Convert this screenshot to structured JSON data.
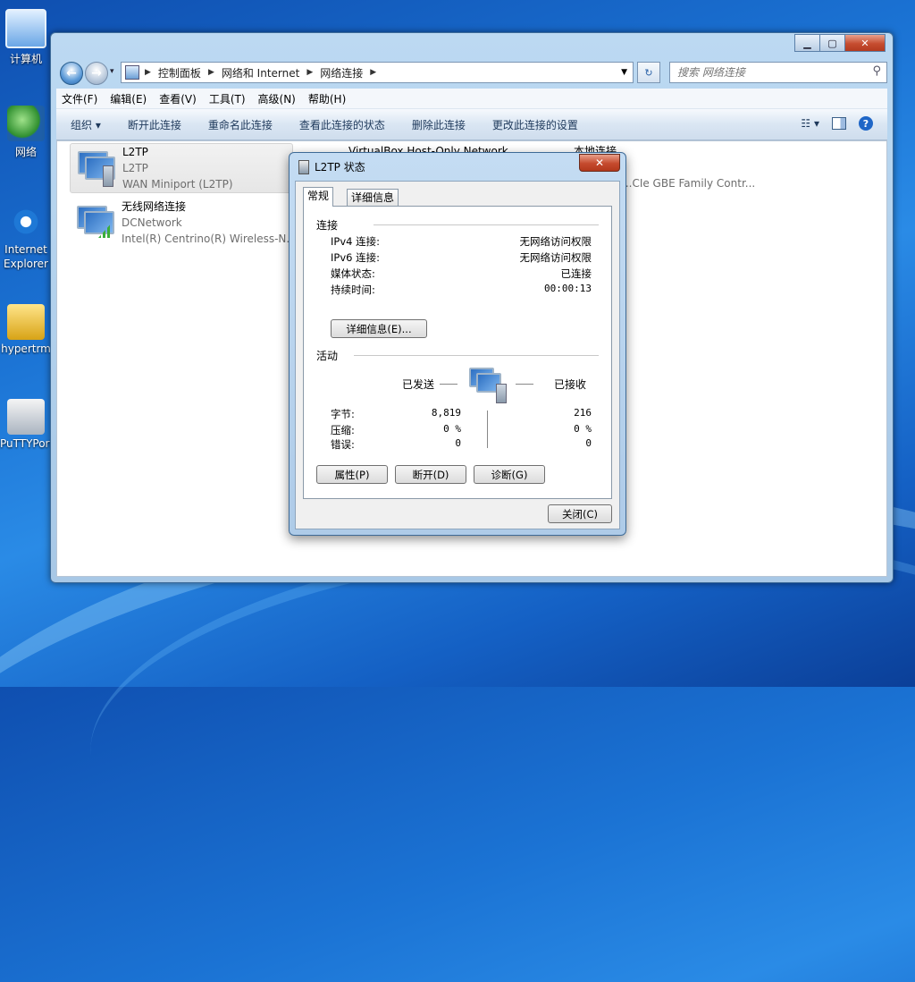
{
  "desktop": {
    "icons": [
      {
        "label": "计算机"
      },
      {
        "label": "网络"
      },
      {
        "label": "Internet Explorer"
      },
      {
        "label": "hypertrm"
      },
      {
        "label": "PuTTYPortable"
      }
    ]
  },
  "window": {
    "address": {
      "segments": [
        "控制面板",
        "网络和 Internet",
        "网络连接"
      ]
    },
    "search": {
      "placeholder": "搜索 网络连接"
    },
    "menu": [
      "文件(F)",
      "编辑(E)",
      "查看(V)",
      "工具(T)",
      "高级(N)",
      "帮助(H)"
    ],
    "commands": [
      "组织 ▾",
      "断开此连接",
      "重命名此连接",
      "查看此连接的状态",
      "删除此连接",
      "更改此连接的设置"
    ],
    "connections": [
      {
        "name": "L2TP",
        "line2": "L2TP",
        "line3": "WAN Miniport (L2TP)"
      },
      {
        "name": "无线网络连接",
        "line2": "DCNetwork",
        "line3": "Intel(R) Centrino(R) Wireless-N..."
      },
      {
        "name": "VirtualBox Host-Only Network",
        "line2": "",
        "line3": ""
      },
      {
        "name": "本地连接",
        "line2": "",
        "line3": "...CIe GBE Family Contr..."
      }
    ]
  },
  "dialog": {
    "title": "L2TP 状态",
    "close_glyph": "✕",
    "tabs": [
      "常规",
      "详细信息"
    ],
    "connection": {
      "heading": "连接",
      "rows": [
        {
          "label": "IPv4 连接:",
          "value": "无网络访问权限"
        },
        {
          "label": "IPv6 连接:",
          "value": "无网络访问权限"
        },
        {
          "label": "媒体状态:",
          "value": "已连接"
        },
        {
          "label": "持续时间:",
          "value": "00:00:13"
        }
      ],
      "details_button": "详细信息(E)..."
    },
    "activity": {
      "heading": "活动",
      "sent_label": "已发送",
      "received_label": "已接收",
      "rows": [
        {
          "label": "字节:",
          "sent": "8,819",
          "received": "216"
        },
        {
          "label": "压缩:",
          "sent": "0 %",
          "received": "0 %"
        },
        {
          "label": "错误:",
          "sent": "0",
          "received": "0"
        }
      ]
    },
    "buttons": {
      "properties": "属性(P)",
      "disconnect": "断开(D)",
      "diagnose": "诊断(G)",
      "close": "关闭(C)"
    }
  }
}
